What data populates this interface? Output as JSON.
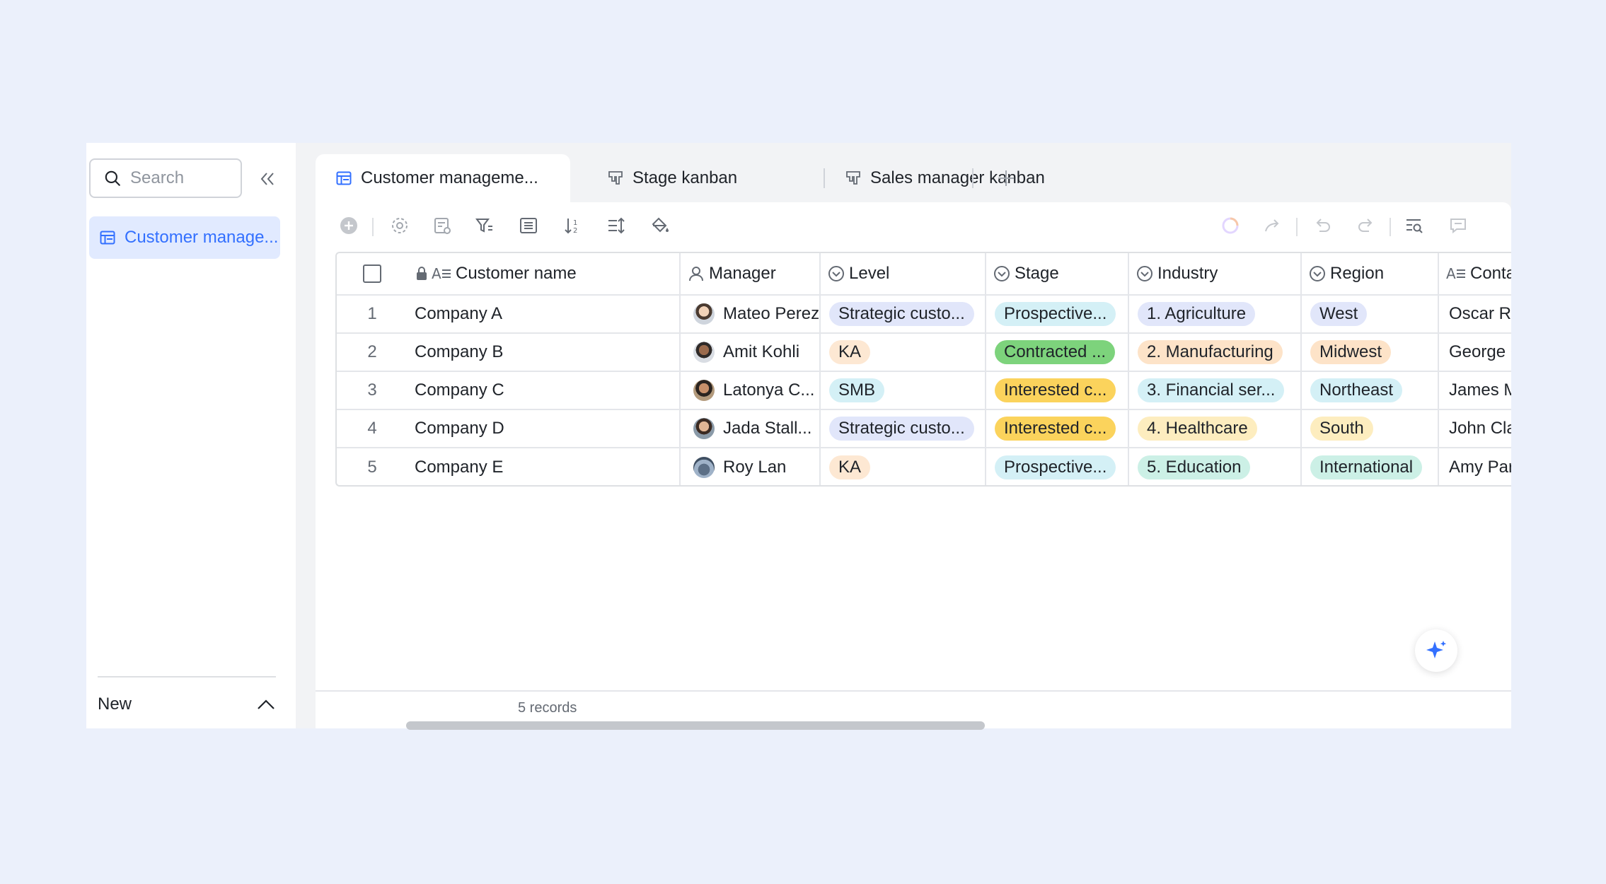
{
  "sidebar": {
    "search_placeholder": "Search",
    "items": [
      {
        "label": "Customer manage..."
      }
    ],
    "new_label": "New"
  },
  "tabs": [
    {
      "label": "Customer manageme...",
      "icon": "grid-table-icon",
      "active": true
    },
    {
      "label": "Stage kanban",
      "icon": "kanban-icon"
    },
    {
      "label": "Sales manager kanban",
      "icon": "kanban-icon"
    }
  ],
  "table": {
    "columns": [
      {
        "label": "Customer name",
        "icon": "text-field-icon"
      },
      {
        "label": "Manager",
        "icon": "person-icon"
      },
      {
        "label": "Level",
        "icon": "single-select-icon"
      },
      {
        "label": "Stage",
        "icon": "single-select-icon"
      },
      {
        "label": "Industry",
        "icon": "single-select-icon"
      },
      {
        "label": "Region",
        "icon": "single-select-icon"
      },
      {
        "label": "Contact",
        "icon": "text-field-icon"
      }
    ],
    "rows": [
      {
        "num": "1",
        "customer": "Company A",
        "manager": "Mateo Perez",
        "level": "Strategic custo...",
        "stage": "Prospective...",
        "industry": "1. Agriculture",
        "region": "West",
        "contact": "Oscar Ramos"
      },
      {
        "num": "2",
        "customer": "Company B",
        "manager": "Amit Kohli",
        "level": "KA",
        "stage": "Contracted ...",
        "industry": "2. Manufacturing",
        "region": "Midwest",
        "contact": "George Gianni"
      },
      {
        "num": "3",
        "customer": "Company C",
        "manager": "Latonya C...",
        "level": "SMB",
        "stage": "Interested c...",
        "industry": "3. Financial ser...",
        "region": "Northeast",
        "contact": "James Morris"
      },
      {
        "num": "4",
        "customer": "Company D",
        "manager": "Jada Stall...",
        "level": "Strategic custo...",
        "stage": "Interested c...",
        "industry": "4. Healthcare",
        "region": "South",
        "contact": "John Clark"
      },
      {
        "num": "5",
        "customer": "Company E",
        "manager": "Roy Lan",
        "level": "KA",
        "stage": "Prospective...",
        "industry": "5. Education",
        "region": "International",
        "contact": "Amy Park"
      }
    ]
  },
  "footer": {
    "records": "5 records"
  },
  "colors": {
    "accent": "#3370ff",
    "tag_level_strategic": "#e1e6fa",
    "tag_level_ka": "#fde8d3",
    "tag_level_smb": "#d4f0f6",
    "tag_stage_prospective": "#d4f0f6",
    "tag_stage_contracted": "#7dd37c",
    "tag_stage_interested": "#fbd35c",
    "tag_industry_agriculture": "#e1e6fa",
    "tag_industry_manufacturing": "#fde3c8",
    "tag_industry_financial": "#d4f0f6",
    "tag_industry_healthcare": "#fdedbf",
    "tag_industry_education": "#ccf0e6",
    "tag_region_west": "#e1e6fa",
    "tag_region_midwest": "#fde3c8",
    "tag_region_northeast": "#d4f0f6",
    "tag_region_south": "#fdedbf",
    "tag_region_international": "#ccf0e6"
  }
}
